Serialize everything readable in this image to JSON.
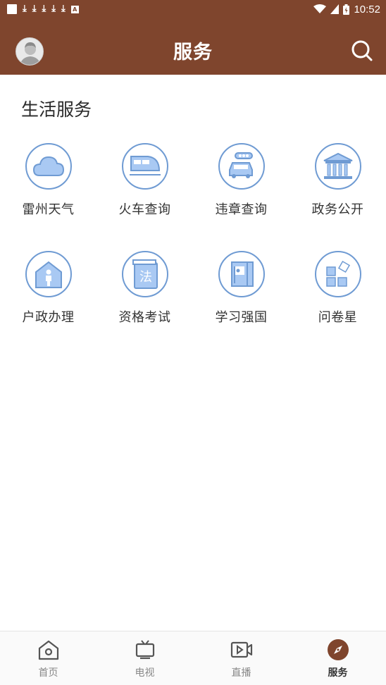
{
  "status_bar": {
    "time": "10:52",
    "notification_icons": [
      "app-square-icon",
      "download-icon",
      "download-icon",
      "download-icon",
      "download-icon",
      "download-icon",
      "a-badge-icon"
    ],
    "a_badge": "A"
  },
  "header": {
    "title": "服务"
  },
  "section": {
    "title": "生活服务"
  },
  "services": [
    {
      "label": "雷州天气",
      "icon": "cloud-icon"
    },
    {
      "label": "火车查询",
      "icon": "train-icon"
    },
    {
      "label": "违章查询",
      "icon": "car-icon"
    },
    {
      "label": "政务公开",
      "icon": "government-building-icon"
    },
    {
      "label": "户政办理",
      "icon": "house-person-icon"
    },
    {
      "label": "资格考试",
      "icon": "law-book-icon"
    },
    {
      "label": "学习强国",
      "icon": "party-flag-book-icon"
    },
    {
      "label": "问卷星",
      "icon": "blocks-icon"
    }
  ],
  "tabs": [
    {
      "label": "首页",
      "icon": "home-icon",
      "active": false
    },
    {
      "label": "电视",
      "icon": "tv-icon",
      "active": false
    },
    {
      "label": "直播",
      "icon": "live-video-icon",
      "active": false
    },
    {
      "label": "服务",
      "icon": "compass-icon",
      "active": true
    }
  ],
  "colors": {
    "brand": "#7f452d",
    "icon_blue": "#6f9bd3",
    "icon_fill": "#a9c9f3"
  }
}
